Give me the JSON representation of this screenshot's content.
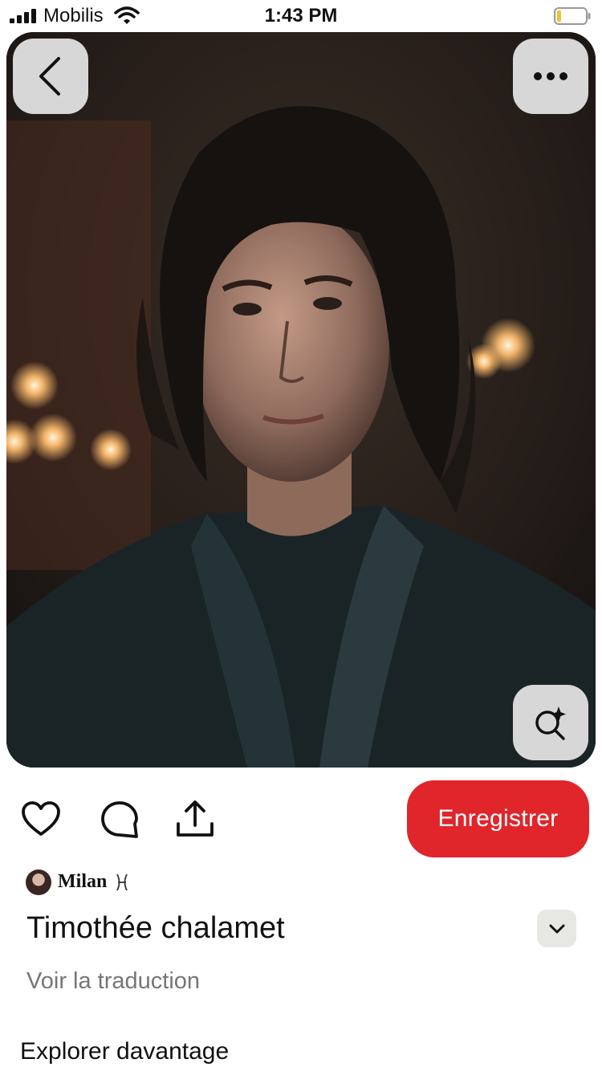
{
  "status_bar": {
    "carrier": "Mobilis",
    "time": "1:43 PM",
    "battery_color": "#f2c230"
  },
  "pin": {
    "image_icons": {
      "back": "chevron-left-icon",
      "more": "more-horizontal-icon",
      "visual_search": "sparkle-search-icon"
    },
    "actions": {
      "like_icon": "heart-icon",
      "comment_icon": "comment-bubble-icon",
      "share_icon": "share-upload-icon",
      "save_label": "Enregistrer"
    },
    "author": {
      "name": "Milan",
      "badge": "pisces-icon"
    },
    "title": "Timothée chalamet",
    "translate_label": "Voir la traduction"
  },
  "more_section": {
    "title": "Explorer davantage"
  },
  "colors": {
    "accent": "#e0252b",
    "button_bg": "#e2e2e2",
    "muted_text": "#767676"
  }
}
